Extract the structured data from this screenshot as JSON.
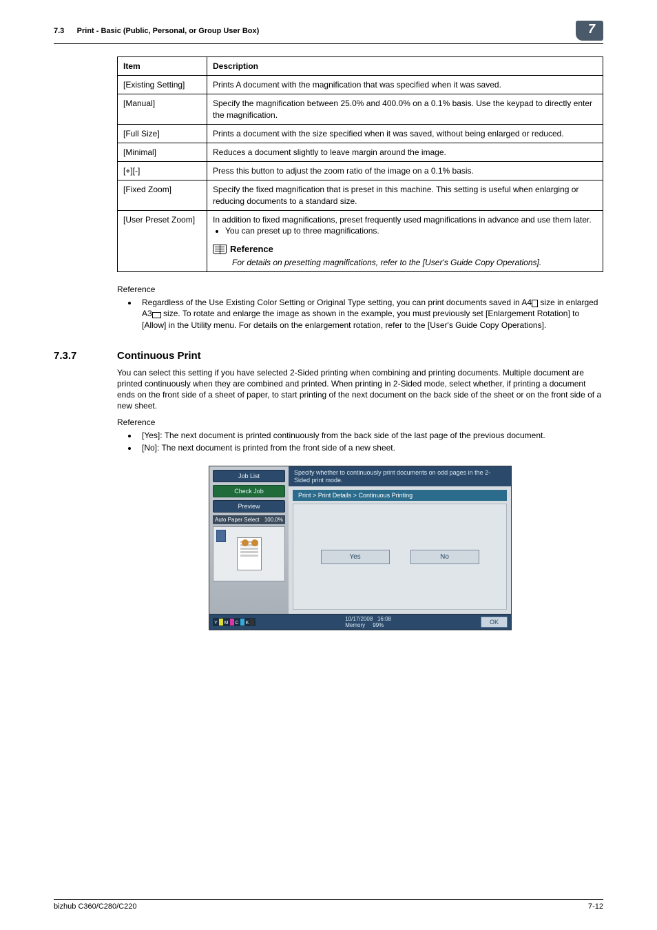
{
  "header": {
    "section_number": "7.3",
    "section_title": "Print - Basic (Public, Personal, or Group User Box)",
    "chapter_number": "7"
  },
  "table": {
    "headers": {
      "item": "Item",
      "description": "Description"
    },
    "rows": [
      {
        "item": "[Existing Setting]",
        "desc": "Prints A document with the magnification that was specified when it was saved."
      },
      {
        "item": "[Manual]",
        "desc": "Specify the magnification between 25.0% and 400.0% on a 0.1% basis. Use the keypad to directly enter the magnification."
      },
      {
        "item": "[Full Size]",
        "desc": "Prints a document with the size specified when it was saved, without being enlarged or reduced."
      },
      {
        "item": "[Minimal]",
        "desc": "Reduces a document slightly to leave margin around the image."
      },
      {
        "item": "[+][-]",
        "desc": "Press this button to adjust the zoom ratio of the image on a 0.1% basis."
      },
      {
        "item": "[Fixed Zoom]",
        "desc": "Specify the fixed magnification that is preset in this machine. This setting is useful when enlarging or reducing documents to a standard size."
      }
    ],
    "last_row": {
      "item": "[User Preset Zoom]",
      "desc": "In addition to fixed magnifications, preset frequently used magnifications in advance and use them later.",
      "bullet": "You can preset up to three magnifications.",
      "ref_title": "Reference",
      "ref_body": "For details on presetting magnifications, refer to the [User's Guide Copy Operations]."
    }
  },
  "reference1": {
    "label": "Reference",
    "text_before_a4": "Regardless of the Use Existing Color Setting or Original Type setting, you can print documents saved in A4",
    "text_mid": " size in enlarged A3",
    "text_after": " size. To rotate and enlarge the image as shown in the example, you must previously set [Enlargement Rotation] to [Allow] in the Utility menu. For details on the enlargement rotation, refer to the [User's Guide Copy Operations]."
  },
  "section": {
    "number": "7.3.7",
    "title": "Continuous Print",
    "body": "You can select this setting if you have selected 2-Sided printing when combining and printing documents. Multiple document are printed continuously when they are combined and printed. When printing in 2-Sided mode, select whether, if printing a document ends on the front side of a sheet of paper, to start printing of the next document on the back side of the sheet or on the front side of a new sheet."
  },
  "reference2": {
    "label": "Reference",
    "bullets": [
      "[Yes]: The next document is printed continuously from the back side of the last page of the previous document.",
      "[No]: The next document is printed from the front side of a new sheet."
    ]
  },
  "screenshot": {
    "job_list": "Job List",
    "check_job": "Check Job",
    "preview": "Preview",
    "auto_paper": "Auto Paper Select",
    "ratio": "100.0%",
    "instruction": "Specify whether to continuously print documents on odd pages in the 2-Sided print mode.",
    "breadcrumb": "Print > Print Details > Continuous Printing",
    "yes": "Yes",
    "no": "No",
    "date": "10/17/2008",
    "time": "16:08",
    "memory_label": "Memory",
    "memory_value": "99%",
    "ok": "OK",
    "toner": {
      "y": "Y",
      "m": "M",
      "c": "C",
      "k": "K"
    }
  },
  "footer": {
    "model": "bizhub C360/C280/C220",
    "page": "7-12"
  }
}
